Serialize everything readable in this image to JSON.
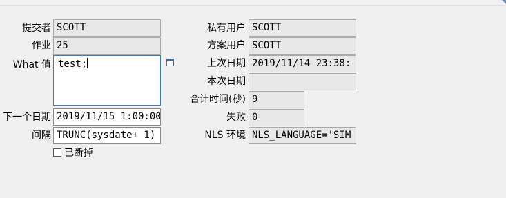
{
  "left": {
    "submitter_label": "提交者",
    "submitter_value": "SCOTT",
    "job_label": "作业",
    "job_value": "25",
    "what_label": "What 值",
    "what_value": "test;",
    "next_date_label": "下一个日期",
    "next_date_value": "2019/11/15 1:00:00",
    "interval_label": "间隔",
    "interval_value": "TRUNC(sysdate+ 1)",
    "broken_label": "已断掉",
    "broken_checked": false
  },
  "right": {
    "private_user_label": "私有用户",
    "private_user_value": "SCOTT",
    "schema_user_label": "方案用户",
    "schema_user_value": "SCOTT",
    "last_date_label": "上次日期",
    "last_date_value": "2019/11/14 23:38:",
    "this_date_label": "本次日期",
    "this_date_value": "",
    "total_time_label": "合计时间(秒)",
    "total_time_value": "9",
    "failures_label": "失败",
    "failures_value": "0",
    "nls_label": "NLS 环境",
    "nls_value": "NLS_LANGUAGE='SIM"
  },
  "icons": {
    "edit": "edit-window-icon"
  }
}
